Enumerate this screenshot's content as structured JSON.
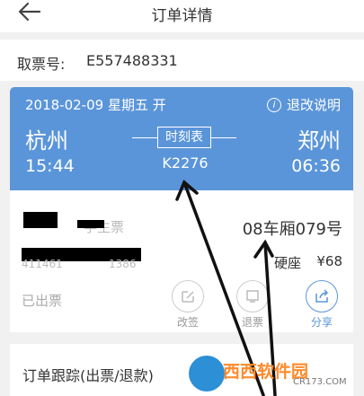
{
  "header": {
    "title": "订单详情",
    "back_icon": "back-arrow-icon"
  },
  "ticket": {
    "label": "取票号:",
    "number": "E557488331"
  },
  "trip": {
    "date_line": "2018-02-09 星期五 开",
    "refund_label": "退改说明",
    "from_city": "杭州",
    "to_city": "郑州",
    "departure_time": "15:44",
    "arrival_time": "06:36",
    "schedule_label": "时刻表",
    "train_no": "K2276",
    "accent_color": "#5b95d9"
  },
  "passenger": {
    "ticket_type": "学生票",
    "seat": "08车厢079号",
    "seat_type": "硬座",
    "price": "¥68",
    "status": "已出票",
    "id_partial_left": "411461",
    "id_partial_right": "1386"
  },
  "actions": [
    {
      "label": "改签",
      "icon": "edit-icon"
    },
    {
      "label": "退票",
      "icon": "refund-icon"
    },
    {
      "label": "分享",
      "icon": "share-icon"
    }
  ],
  "tracking": {
    "title": "订单跟踪(出票/退款)"
  },
  "watermark": {
    "cn": "西西软件园",
    "url": "CR173.COM"
  }
}
